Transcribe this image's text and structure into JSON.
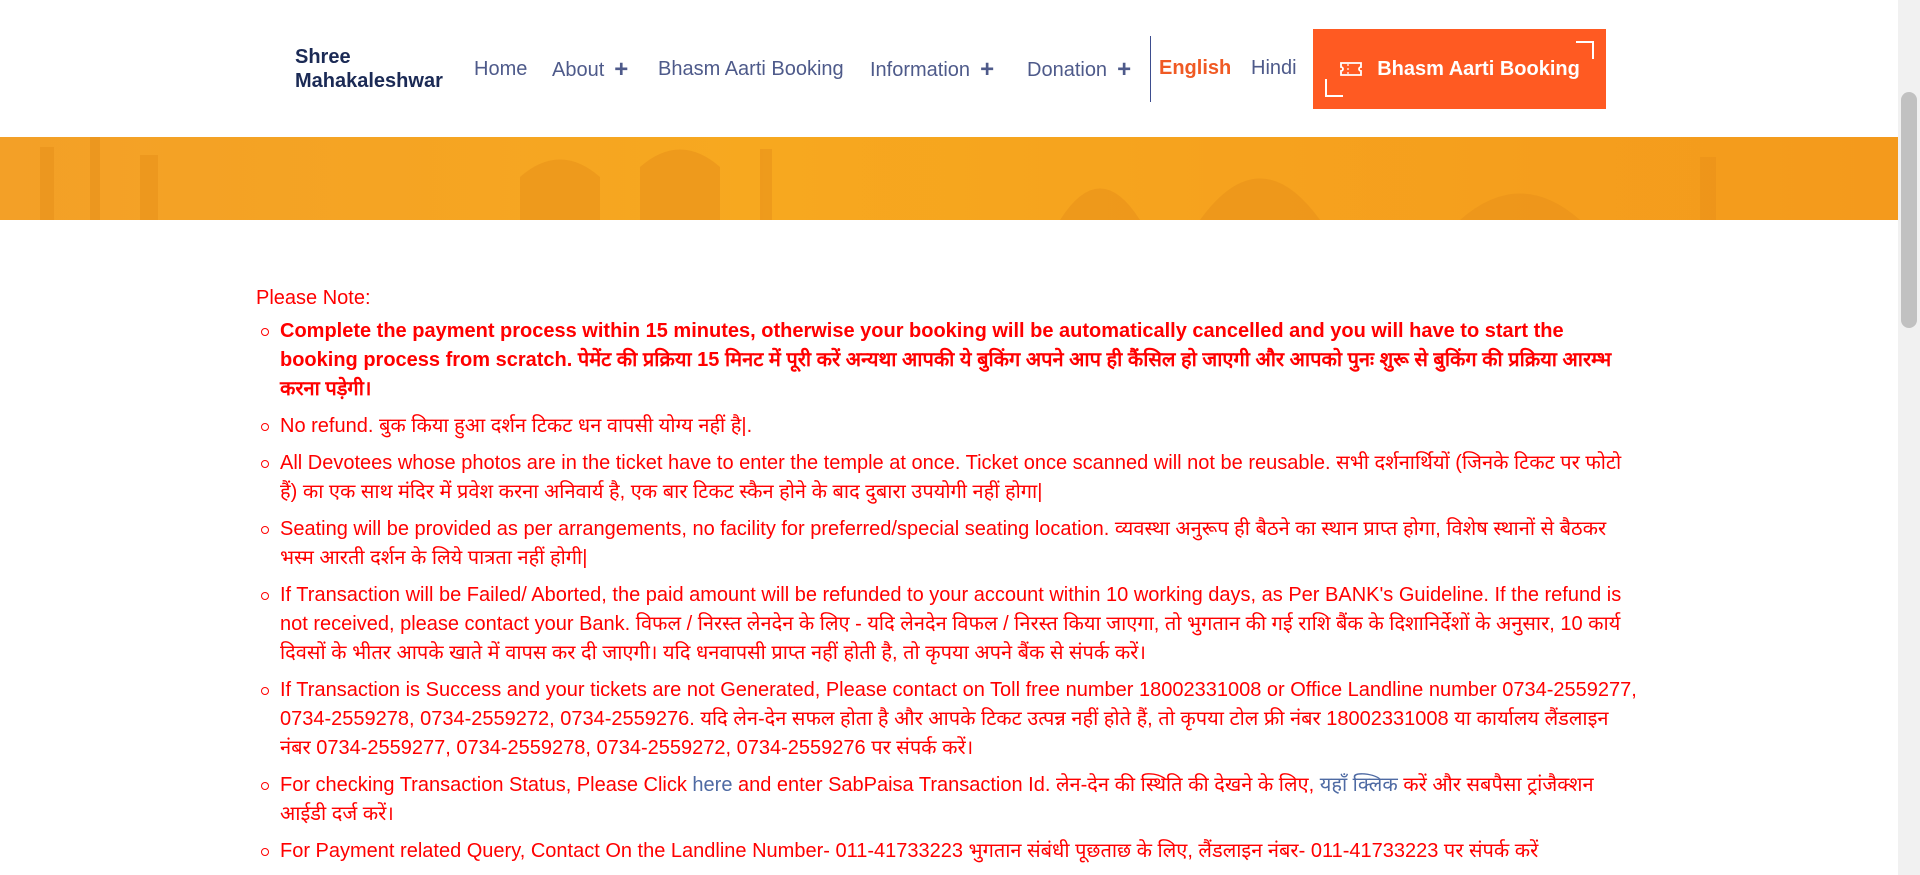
{
  "header": {
    "logo_line1": "Shree",
    "logo_line2": "Mahakaleshwar",
    "nav": {
      "home": "Home",
      "about": "About",
      "bhasm": "Bhasm Aarti Booking",
      "information": "Information",
      "donation": "Donation",
      "plus": "+"
    },
    "lang_english": "English",
    "lang_hindi": "Hindi",
    "cta_label": "Bhasm Aarti Booking",
    "colors": {
      "accent": "#ff5a22",
      "nav_text": "#4e5a8a",
      "logo": "#1b2a55"
    }
  },
  "banner": {
    "color": "#f7a81f"
  },
  "notes": {
    "title": "Please Note:",
    "items": [
      {
        "text": "Complete the payment process within 15 minutes, otherwise your booking will be automatically cancelled and you will have to start the booking process from scratch. पेमेंट की प्रक्रिया 15 मिनट में पूरी करें अन्यथा आपकी ये बुकिंग अपने आप ही कैंसिल हो जाएगी और आपको पुनः शुरू से बुकिंग की प्रक्रिया आरम्भ करना पड़ेगी।"
      },
      {
        "text": "No refund. बुक किया हुआ दर्शन टिकट धन वापसी योग्य नहीं है|."
      },
      {
        "text": "All Devotees whose photos are in the ticket have to enter the temple at once. Ticket once scanned will not be reusable. सभी दर्शनार्थियों (जिनके टिकट पर फोटो हैं) का एक साथ मंदिर में प्रवेश करना अनिवार्य है, एक बार टिकट स्कैन होने के बाद दुबारा उपयोगी नहीं होगा|"
      },
      {
        "text": "Seating will be provided as per arrangements, no facility for preferred/special seating location. व्यवस्था अनुरूप ही बैठने का स्थान प्राप्त होगा, विशेष स्थानों से बैठकर भस्म आरती दर्शन के लिये पात्रता नहीं होगी|"
      },
      {
        "text": "If Transaction will be Failed/ Aborted, the paid amount will be refunded to your account within 10 working days, as Per BANK's Guideline. If the refund is not received, please contact your Bank. विफल / निरस्त लेनदेन के लिए - यदि लेनदेन विफल / निरस्त किया जाएगा, तो भुगतान की गई राशि बैंक के दिशानिर्देशों के अनुसार, 10 कार्य दिवसों के भीतर आपके खाते में वापस कर दी जाएगी। यदि धनवापसी प्राप्त नहीं होती है, तो कृपया अपने बैंक से संपर्क करें।"
      },
      {
        "text": "If Transaction is Success and your tickets are not Generated, Please contact on Toll free number 18002331008 or Office Landline number 0734-2559277, 0734-2559278, 0734-2559272, 0734-2559276. यदि लेन-देन सफल होता है और आपके टिकट उत्पन्न नहीं होते हैं, तो कृपया टोल फ्री नंबर 18002331008 या कार्यालय लैंडलाइन नंबर 0734-2559277, 0734-2559278, 0734-2559272, 0734-2559276 पर संपर्क करें।"
      },
      {
        "part1": "For checking Transaction Status, Please Click ",
        "link1": "here",
        "part2": " and enter SabPaisa Transaction Id. लेन-देन की स्थिति की देखने के लिए, ",
        "link2": "यहाँ क्लिक",
        "part3": " करें और सबपैसा ट्रांजैक्शन आईडी दर्ज करें।"
      },
      {
        "text": "For Payment related Query, Contact On the Landline Number- 011-41733223 भुगतान संबंधी पूछताछ के लिए, लैंडलाइन नंबर- 011-41733223 पर संपर्क करें"
      }
    ]
  }
}
